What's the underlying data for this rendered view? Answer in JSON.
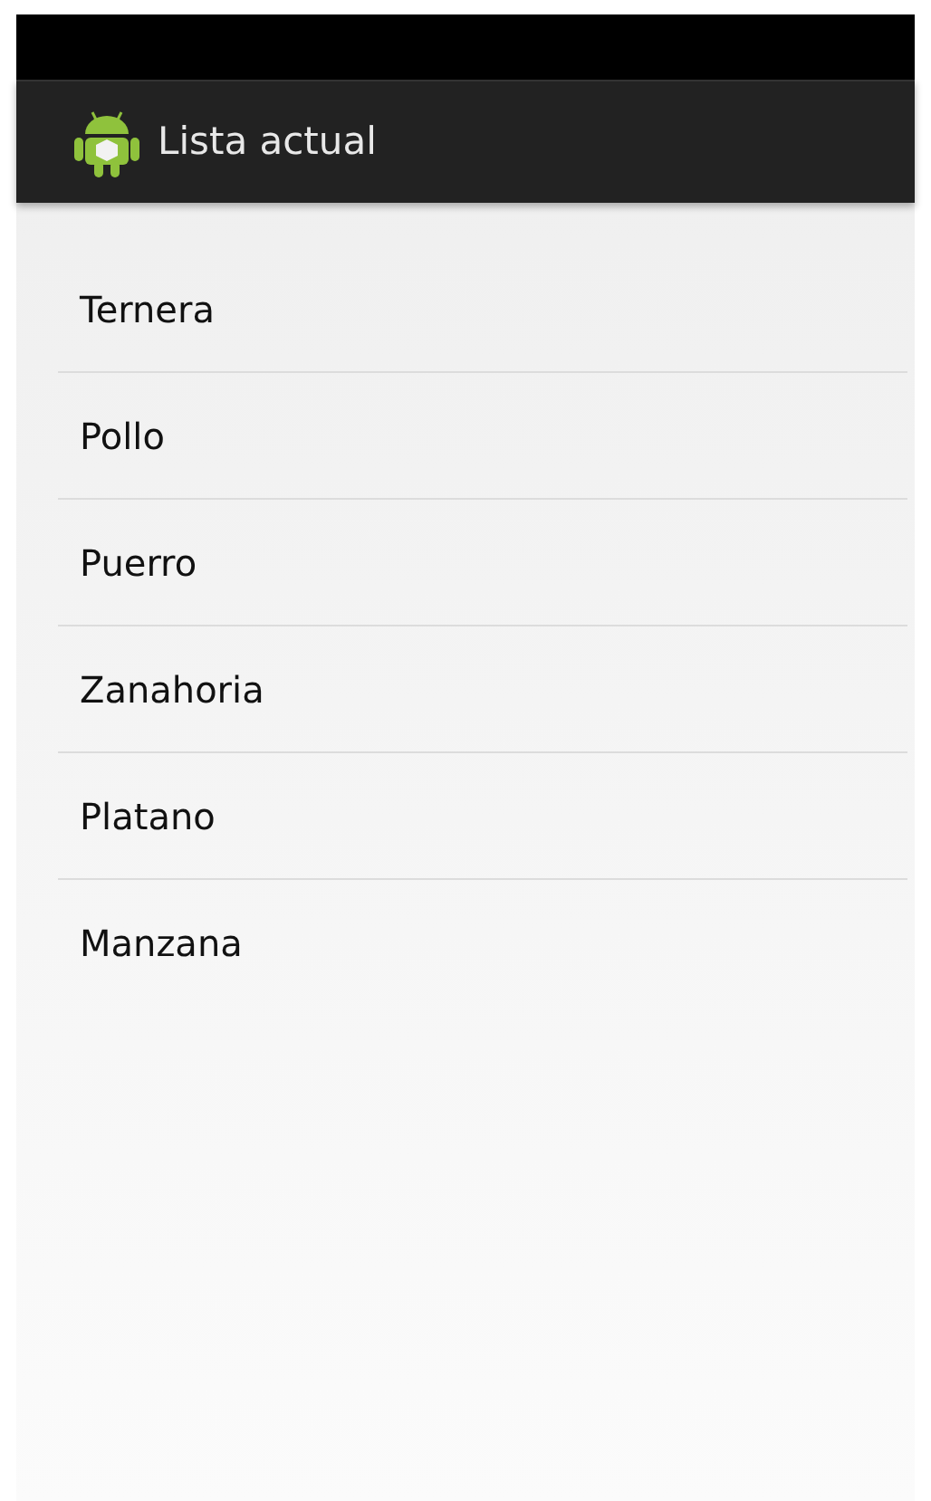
{
  "action_bar": {
    "title": "Lista actual"
  },
  "list": {
    "items": [
      {
        "label": "Ternera"
      },
      {
        "label": "Pollo"
      },
      {
        "label": "Puerro"
      },
      {
        "label": "Zanahoria"
      },
      {
        "label": "Platano"
      },
      {
        "label": "Manzana"
      }
    ]
  }
}
